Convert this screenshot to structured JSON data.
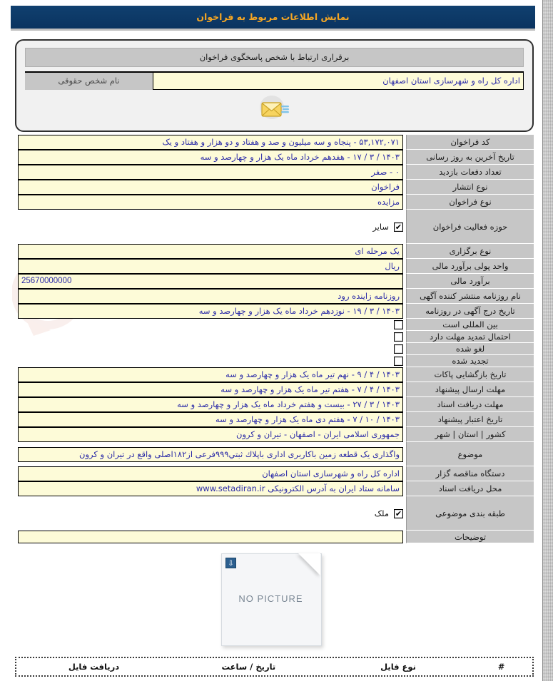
{
  "window": {
    "title": "نمایش اطلاعات مربوط به فراخوان"
  },
  "contact_panel": {
    "header": "برقراری ارتباط با شخص پاسخگوی فراخوان",
    "label": "نام شخص حقوقی",
    "value": "اداره کل راه و شهرسازی استان اصفهان",
    "mail_icon": "envelope-icon"
  },
  "rows": [
    {
      "label": "کد فراخوان",
      "value": "۵۳,۱۷۲,۰۷۱ - پنجاه و سه میلیون و صد و هفتاد و دو هزار و هفتاد و یک",
      "type": "field"
    },
    {
      "label": "تاریخ آخرین به روز رسانی",
      "value": "۱۴۰۳ / ۳ / ۱۷ - هفدهم خرداد ماه یک هزار و چهارصد و سه",
      "type": "field"
    },
    {
      "label": "تعداد دفعات بازدید",
      "value": "۰ - صفر",
      "type": "field"
    },
    {
      "label": "نوع انتشار",
      "value": "فراخوان",
      "type": "field"
    },
    {
      "label": "نوع فراخوان",
      "value": "مزایده",
      "type": "field"
    },
    {
      "label": "حوزه فعالیت فراخوان",
      "value": "سایر",
      "type": "checkbox",
      "checked": true
    },
    {
      "label": "نوع برگزاری",
      "value": "یک مرحله ای",
      "type": "field"
    },
    {
      "label": "واحد پولی برآورد مالی",
      "value": "ریال",
      "type": "field"
    },
    {
      "label": "برآورد مالی",
      "value": "25670000000",
      "type": "field-ltr"
    },
    {
      "label": "نام روزنامه منتشر کننده آگهی",
      "value": "روزنامه زاینده رود",
      "type": "field"
    },
    {
      "label": "تاریخ درج آگهی در روزنامه",
      "value": "۱۴۰۳ / ۳ / ۱۹ - نوزدهم خرداد ماه یک هزار و چهارصد و سه",
      "type": "field"
    },
    {
      "label": "بین المللی است",
      "value": "",
      "type": "flag",
      "checked": false
    },
    {
      "label": "احتمال تمدید مهلت دارد",
      "value": "",
      "type": "flag",
      "checked": false
    },
    {
      "label": "لغو شده",
      "value": "",
      "type": "flag",
      "checked": false
    },
    {
      "label": "تجدید شده",
      "value": "",
      "type": "flag",
      "checked": false
    },
    {
      "label": "تاریخ بازگشایی پاکات",
      "value": "۱۴۰۳ / ۴ / ۹ - نهم تیر ماه یک هزار و چهارصد و سه",
      "type": "field"
    },
    {
      "label": "مهلت ارسال پیشنهاد",
      "value": "۱۴۰۳ / ۴ / ۷ - هفتم تیر ماه یک هزار و چهارصد و سه",
      "type": "field"
    },
    {
      "label": "مهلت دریافت اسناد",
      "value": "۱۴۰۳ / ۳ / ۲۷ - بیست و هفتم خرداد ماه یک هزار و چهارصد و سه",
      "type": "field"
    },
    {
      "label": "تاریخ اعتبار پیشنهاد",
      "value": "۱۴۰۳ / ۱۰ / ۷ - هفتم دی ماه یک هزار و چهارصد و سه",
      "type": "field"
    },
    {
      "label": "کشور | استان | شهر",
      "value": "جمهوری اسلامی ایران - اصفهان - تیران و کرون",
      "type": "field"
    },
    {
      "label": "موضوع",
      "value": "واگذاری یک قطعه زمین باکاربری اداری باپلاك ثبتي۹۹۹فرعی از۱۸۲اصلی واقع در تیران و کرون",
      "type": "field-tall"
    },
    {
      "label": "دستگاه مناقصه گزار",
      "value": "اداره کل راه و شهرسازی استان اصفهان",
      "type": "field"
    },
    {
      "label": "محل دریافت اسناد",
      "value": "سامانه ستاد ایران به آدرس الکترونیکی www.setadiran.ir",
      "type": "field"
    },
    {
      "label": "طبقه بندی موضوعی",
      "value": "ملک",
      "type": "checkbox",
      "checked": true
    },
    {
      "label": "توضیحات",
      "value": "",
      "type": "field"
    }
  ],
  "no_picture": {
    "caption": "NO PICTURE",
    "broken_icon": "broken-image-icon"
  },
  "files_table": {
    "columns": [
      "#",
      "نوع فایل",
      "تاریخ / ساعت",
      "دریافت فایل"
    ],
    "rows": []
  },
  "watermark": {
    "text": "AriaTender.net"
  },
  "colors": {
    "titlebar_bg": "#0d3b68",
    "titlebar_text": "#f5a623",
    "label_bg": "#c6c6c6",
    "field_bg": "#fdfbd8",
    "field_text": "#2c2ca8"
  }
}
